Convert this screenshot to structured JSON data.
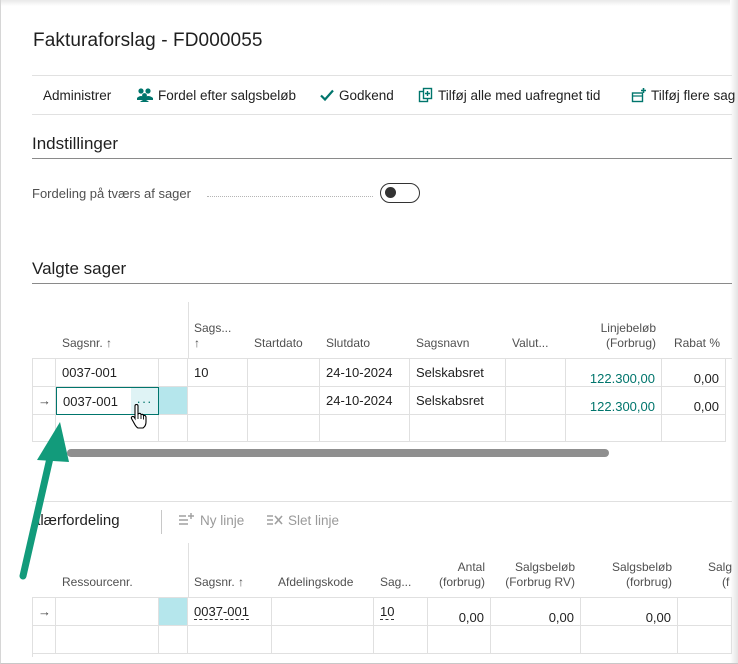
{
  "page": {
    "title": "Fakturaforslag - FD000055"
  },
  "actions": {
    "manage": "Administrer",
    "distribute": "Fordel efter salgsbeløb",
    "approve": "Godkend",
    "add_all": "Tilføj alle med uafregnet tid",
    "add_more": "Tilføj flere sag"
  },
  "settings": {
    "title": "Indstillinger",
    "cross_projects_label": "Fordeling på tværs af sager",
    "cross_projects_value": "off"
  },
  "selected": {
    "title": "Valgte sager",
    "columns": {
      "sagsnr": "Sagsnr. ↑",
      "sags_line1": "Sags...",
      "sags_line2": "↑",
      "startdato": "Startdato",
      "slutdato": "Slutdato",
      "sagsnavn": "Sagsnavn",
      "valuta": "Valut...",
      "linjebelob_line1": "Linjebeløb",
      "linjebelob_line2": "(Forbrug)",
      "rabat": "Rabat %"
    },
    "rows": [
      {
        "sagsnr": "0037-001",
        "sags": "10",
        "startdato": "",
        "slutdato": "24-10-2024",
        "sagsnavn": "Selskabsret",
        "valuta": "",
        "linjebelob": "122.300,00",
        "rabat": "0,00"
      },
      {
        "sagsnr": "0037-001",
        "sags": "",
        "startdato": "",
        "slutdato": "24-10-2024",
        "sagsnavn": "Selskabsret",
        "valuta": "",
        "linjebelob": "122.300,00",
        "rabat": "0,00"
      }
    ],
    "row_marker": "→",
    "ellipsis": "···"
  },
  "distribution": {
    "title": "alærfordeling",
    "new_line": "Ny linje",
    "delete_line": "Slet linje",
    "columns": {
      "ressourcenr": "Ressourcenr.",
      "sagsnr": "Sagsnr. ↑",
      "afdeling": "Afdelingskode",
      "sag": "Sag...",
      "antal_line1": "Antal",
      "antal_line2": "(forbrug)",
      "salg_rv_line1": "Salgsbeløb",
      "salg_rv_line2": "(Forbrug RV)",
      "salg_line1": "Salgsbeløb",
      "salg_line2": "(forbrug)",
      "salg_cut_line1": "Salg",
      "salg_cut_line2": "(f"
    },
    "rows": [
      {
        "ressourcenr": "",
        "sagsnr": "0037-001",
        "afdeling": "",
        "sag": "10",
        "antal": "0,00",
        "salg_rv": "0,00",
        "salg": "0,00"
      }
    ],
    "row_marker": "→"
  },
  "colors": {
    "accent": "#00756c",
    "selected_cell": "#b5e6ec",
    "arrow": "#129b7b"
  }
}
